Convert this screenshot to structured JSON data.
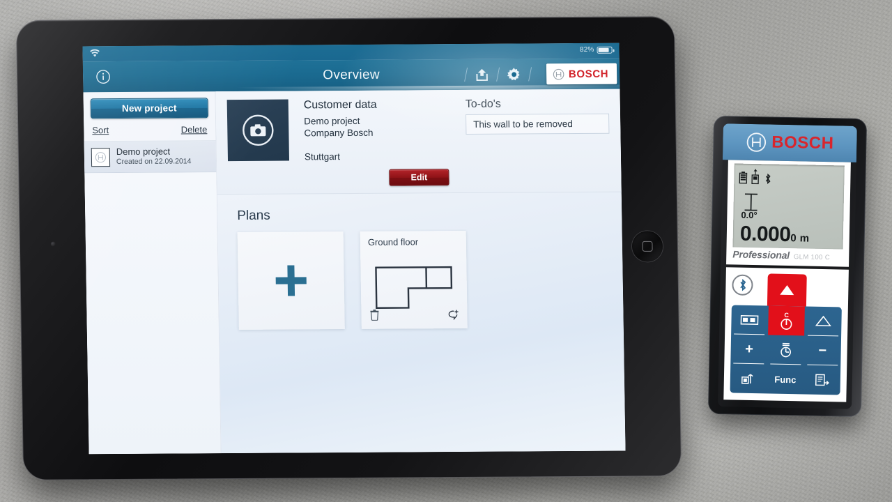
{
  "statusbar": {
    "battery_percent": "82%",
    "wifi_icon": "wifi-icon",
    "battery_icon": "battery-icon"
  },
  "navbar": {
    "title": "Overview",
    "info_icon": "info-icon",
    "share_icon": "share-icon",
    "settings_icon": "gear-icon",
    "brand": "BOSCH",
    "brand_logo_icon": "bosch-logo-icon"
  },
  "sidebar": {
    "new_project_label": "New project",
    "sort_label": "Sort",
    "delete_label": "Delete",
    "projects": [
      {
        "name": "Demo project",
        "created": "Created on 22.09.2014",
        "thumb_icon": "bosch-logo-icon"
      }
    ]
  },
  "customer": {
    "section_title": "Customer data",
    "photo_icon": "camera-icon",
    "line1": "Demo project",
    "line2": "Company Bosch",
    "line3": "Stuttgart"
  },
  "todos": {
    "section_title": "To-do's",
    "items": [
      "This wall to be removed"
    ]
  },
  "actions": {
    "edit_label": "Edit"
  },
  "plans": {
    "section_title": "Plans",
    "add_card": {
      "icon": "plus-icon"
    },
    "cards": [
      {
        "label": "Ground floor",
        "delete_icon": "trash-icon",
        "comment_icon": "add-comment-icon"
      }
    ]
  },
  "device": {
    "brand": "BOSCH",
    "brand_logo_icon": "bosch-logo-icon",
    "professional_label": "Professional",
    "model_label": "GLM 100 C",
    "display": {
      "battery_icon": "battery-icon",
      "reference_icon": "measure-reference-icon",
      "bluetooth_icon": "bluetooth-icon",
      "ruler_icon": "vertical-ruler-icon",
      "angle_value": "0.0°",
      "distance_main": "0.000",
      "distance_sub": "0",
      "distance_unit": "m"
    },
    "keypad": {
      "bluetooth_icon": "bluetooth-icon",
      "measure_icon": "measure-triangle-icon",
      "clear_label": "C",
      "power_icon": "power-icon",
      "area_icon": "area-icon",
      "angle_icon": "angle-icon",
      "plus_label": "+",
      "minus_label": "−",
      "timer_icon": "timer-icon",
      "stakeout_icon": "stakeout-icon",
      "func_label": "Func",
      "memory_icon": "memory-icon"
    }
  },
  "colors": {
    "bosch_red": "#d2232a",
    "bosch_blue": "#1a6a90",
    "edit_red": "#8e1216",
    "accent_plus": "#2a6f92"
  }
}
